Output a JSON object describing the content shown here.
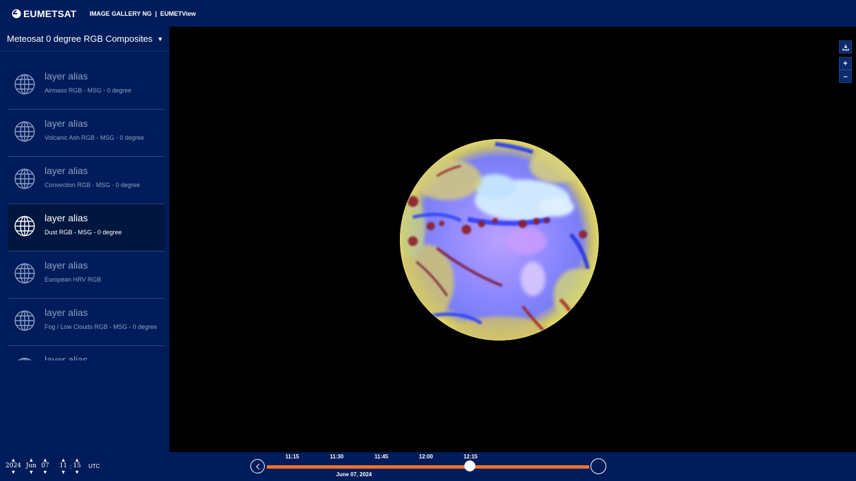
{
  "header": {
    "brand": "EUMETSAT",
    "nav_gallery": "IMAGE GALLERY NG",
    "nav_sep": "|",
    "nav_view": "EUMETView"
  },
  "sidebar": {
    "dropdown_label": "Meteosat 0 degree RGB Composites",
    "layers": [
      {
        "alias": "layer alias",
        "name": "Airmass RGB - MSG - 0 degree"
      },
      {
        "alias": "layer alias",
        "name": "Volcanic Ash RGB - MSG - 0 degree"
      },
      {
        "alias": "layer alias",
        "name": "Convection RGB - MSG - 0 degree"
      },
      {
        "alias": "layer alias",
        "name": "Dust RGB - MSG - 0 degree",
        "active": true
      },
      {
        "alias": "layer alias",
        "name": "European HRV RGB"
      },
      {
        "alias": "layer alias",
        "name": "Fog / Low Clouds RGB - MSG - 0 degree"
      },
      {
        "alias": "layer alias",
        "name": ""
      }
    ]
  },
  "map": {
    "download_icon": "download-icon",
    "zoom_in": "+",
    "zoom_out": "–"
  },
  "datetime": {
    "year": "2024",
    "month": "Jun",
    "day": "07",
    "hour": "11",
    "minute": "15",
    "colon": ":",
    "tz": "UTC"
  },
  "timeline": {
    "ticks": [
      "11:15",
      "11:30",
      "11:45",
      "12:00",
      "12:15"
    ],
    "date": "June 07, 2024",
    "position_fraction": 0.63,
    "bar_color": "#f0712a"
  },
  "colors": {
    "background": "#001c5a",
    "map": "#000000"
  }
}
